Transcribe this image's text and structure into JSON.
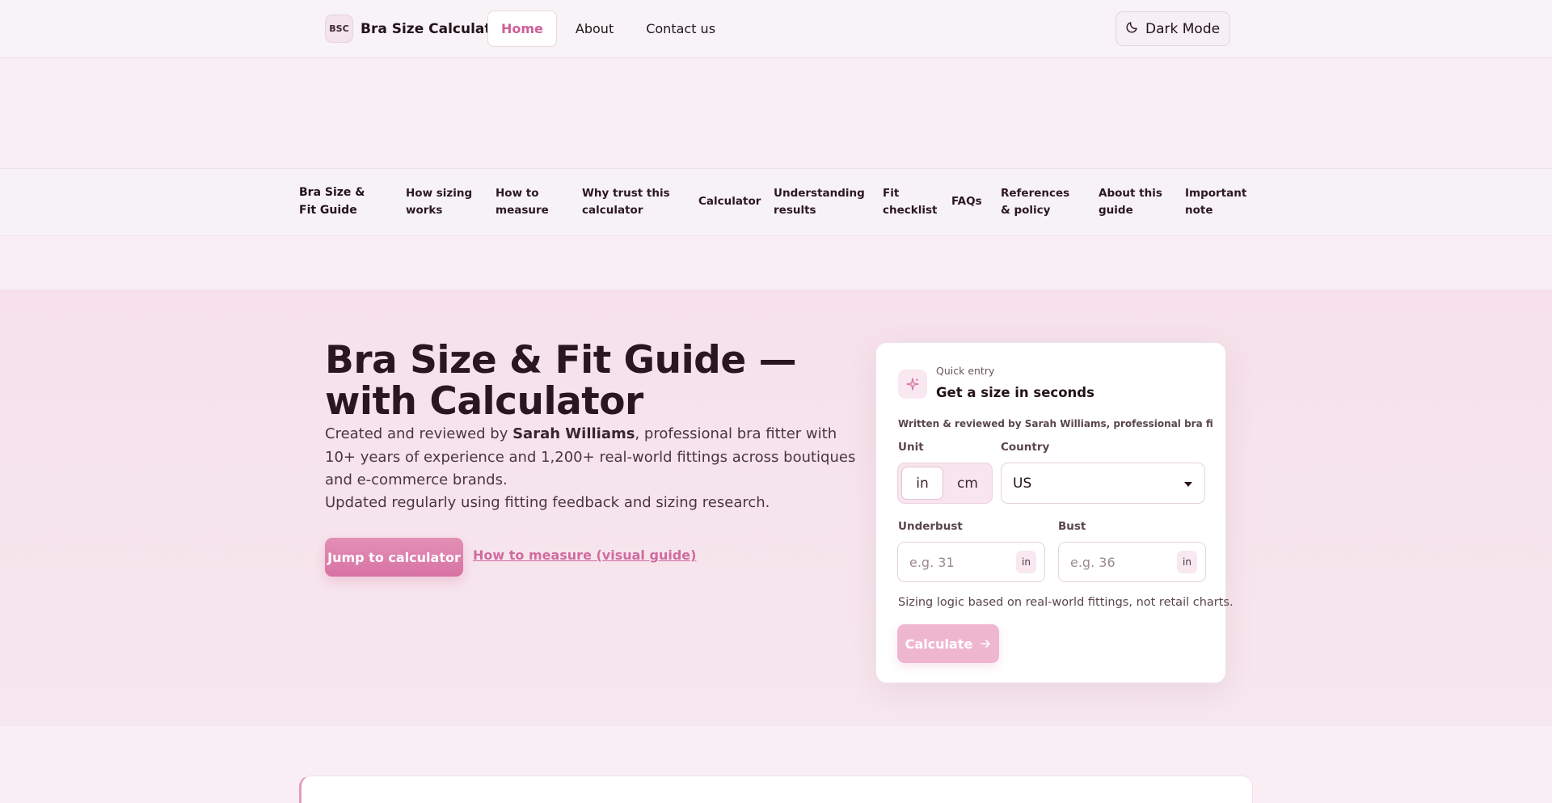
{
  "topbar": {
    "logo_text": "BSC",
    "brand_name": "Bra Size Calculator",
    "nav": [
      {
        "label": "Home",
        "active": true
      },
      {
        "label": "About",
        "active": false
      },
      {
        "label": "Contact us",
        "active": false
      }
    ],
    "dark_mode_label": "Dark Mode"
  },
  "guide_nav": {
    "title": "Bra Size & Fit Guide",
    "items": [
      "How sizing works",
      "How to measure",
      "Why trust this calculator",
      "Calculator",
      "Understanding results",
      "Fit checklist",
      "FAQs",
      "References & policy",
      "About this guide",
      "Important note"
    ]
  },
  "hero": {
    "title": "Bra Size & Fit Guide — with Calculator",
    "desc_prefix": "Created and reviewed by ",
    "desc_author": "Sarah Williams",
    "desc_suffix": ", professional bra fitter with 10+ years of experience and 1,200+ real-world fittings across boutiques and e-commerce brands.",
    "updated": "Updated regularly using fitting feedback and sizing research.",
    "jump_button": "Jump to calculator",
    "howto_link": "How to measure (visual guide)"
  },
  "calculator": {
    "kicker": "Quick entry",
    "title": "Get a size in seconds",
    "author_line": "Written & reviewed by Sarah Williams, professional bra fitter...",
    "unit_label": "Unit",
    "unit_options": [
      "in",
      "cm"
    ],
    "unit_selected": "in",
    "country_label": "Country",
    "country_value": "US",
    "underbust_label": "Underbust",
    "underbust_placeholder": "e.g. 31",
    "underbust_unit": "in",
    "bust_label": "Bust",
    "bust_placeholder": "e.g. 36",
    "bust_unit": "in",
    "note": "Sizing logic based on real-world fittings, not retail charts.",
    "calculate_label": "Calculate"
  },
  "icons": {
    "theme": "moon-icon",
    "card": "sparkle-icon",
    "select": "caret-down-icon",
    "button": "arrow-right-icon"
  },
  "colors": {
    "accent": "#d772a3",
    "accent_light": "#efb6d0",
    "link": "#d06b9f",
    "text": "#2a1620",
    "hero_bg": "#f6e1ea"
  }
}
